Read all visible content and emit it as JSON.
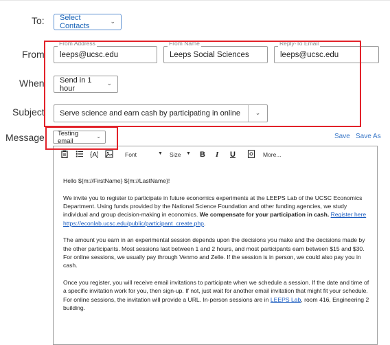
{
  "labels": {
    "to": "To:",
    "from": "From",
    "when": "When",
    "subject": "Subject",
    "message": "Message:"
  },
  "to": {
    "button_label": "Select Contacts"
  },
  "from": {
    "address_caption": "From Address",
    "address_value": "leeps@ucsc.edu",
    "name_caption": "From Name",
    "name_value": "Leeps Social Sciences",
    "reply_caption": "Reply-To Email",
    "reply_value": "leeps@ucsc.edu"
  },
  "when": {
    "value": "Send in 1 hour"
  },
  "subject": {
    "value": "Serve science and earn cash by participating in online an"
  },
  "message": {
    "template_value": "Testing email",
    "save_label": "Save",
    "save_as_label": "Save As"
  },
  "toolbar": {
    "font_label": "Font",
    "size_label": "Size",
    "bold": "B",
    "italic": "I",
    "underline": "U",
    "more_label": "More..."
  },
  "body": {
    "greeting": "Hello ${m://FirstName} ${m://LastName}!",
    "p1_text": "We invite you to register to participate in future economics experiments at the LEEPS Lab of the UCSC Economics Department. Using funds provided by the National Science Foundation and other funding agencies, we study individual and group decision-making in economics. ",
    "p1_bold": "We compensate for your participation in cash.",
    "p1_link": "Register here https://econlab.ucsc.edu/public/participant_create.php",
    "p1_end": ".",
    "p2": "The amount you earn in an experimental session depends upon the decisions you make and the decisions made by the other participants. Most sessions last between 1 and 2 hours, and most participants earn between $15 and $30. For online sessions, we usually pay through Venmo and Zelle. If the session is in person, we could also pay you in cash.",
    "p3_text": "Once you register, you will receive email invitations to participate when we schedule a session. If the date and time of a specific invitation work for you, then sign-up. If not, just wait for another email invitation that might fit your schedule. For online sessions, the invitation will provide a URL. In-person sessions are in ",
    "p3_link": "LEEPS Lab",
    "p3_end": ", room 416, Engineering 2 building."
  },
  "colors": {
    "accent": "#1a64b8",
    "highlight": "#e2222a",
    "link": "#3a78c8"
  }
}
